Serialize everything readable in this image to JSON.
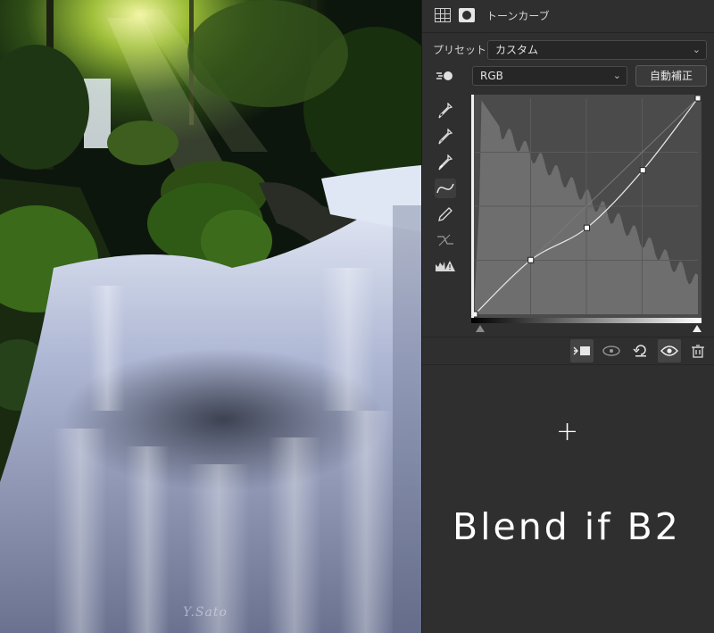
{
  "photo": {
    "alt_subject": "waterfall",
    "signature": "Y.Sato"
  },
  "panel": {
    "title": "トーンカーブ",
    "header_icons": [
      "adjustment-grid-icon",
      "layer-mask-icon"
    ],
    "preset": {
      "label": "プリセット：",
      "value": "カスタム"
    },
    "channel": {
      "value": "RGB"
    },
    "auto_button": "自動補正",
    "tools": [
      "target-adjust-icon",
      "black-point-eyedropper-icon",
      "gray-point-eyedropper-icon",
      "white-point-eyedropper-icon",
      "curve-point-edit-icon",
      "pencil-draw-icon",
      "smooth-curve-icon",
      "clipping-warning-icon"
    ],
    "bottom_tools": [
      "clip-to-layer-icon",
      "view-previous-state-icon",
      "reset-icon",
      "visibility-eye-icon",
      "trash-icon"
    ]
  },
  "curve": {
    "input_range": [
      0,
      255
    ],
    "output_range": [
      0,
      255
    ],
    "points": [
      [
        0,
        0
      ],
      [
        64,
        64
      ],
      [
        128,
        102
      ],
      [
        192,
        170
      ],
      [
        255,
        255
      ]
    ],
    "colors": {
      "curve": "#e8e8e8",
      "histogram": "#6e6e6e",
      "grid": "#5a5a5a",
      "bg": "#4b4b4b"
    }
  },
  "overlay": {
    "plus": "+",
    "caption": "Blend if B2"
  }
}
